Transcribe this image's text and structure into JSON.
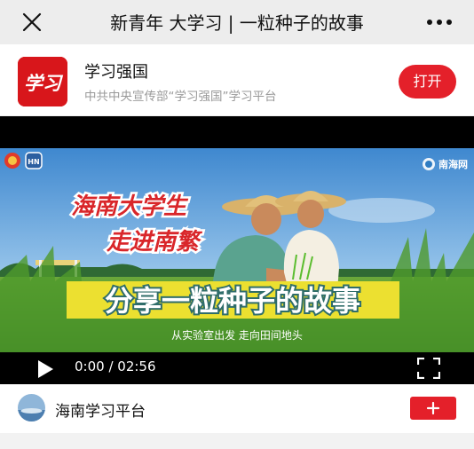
{
  "nav": {
    "title": "新青年 大学习 | 一粒种子的故事",
    "close_icon": "close-icon",
    "more_icon": "more-dots-icon"
  },
  "app_banner": {
    "logo_text": "学习",
    "name": "学习强国",
    "description": "中共中央宣传部“学习强国”学习平台",
    "open_label": "打开"
  },
  "video": {
    "title_line1": "海南大学生",
    "title_line2": "走进南繁",
    "headline": "分享一粒种子的故事",
    "subtitle": "从实验室出发 走向田间地头",
    "watermark": "南海网",
    "current_time": "0:00",
    "separator": "/",
    "duration": "02:56",
    "time_display": "0:00 / 02:56"
  },
  "account": {
    "name": "海南学习平台",
    "follow_icon": "plus-icon"
  },
  "colors": {
    "accent": "#e4202a",
    "nav_bg": "#ededed"
  }
}
